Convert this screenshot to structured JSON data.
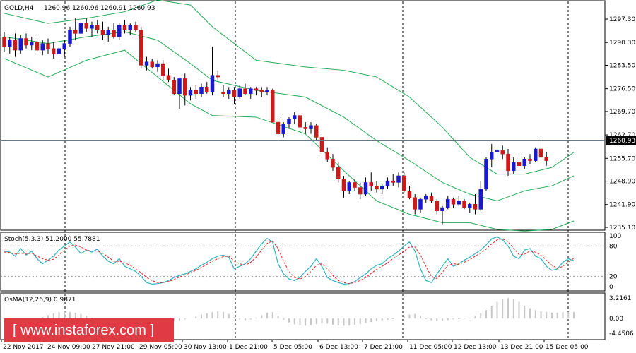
{
  "header": {
    "symbol_label": "GOLD,H4",
    "ohlc_text": "1260.96 1260.96 1260.91 1260.93"
  },
  "price_panel": {
    "current_price": "1260.93",
    "y_ticks": [
      "1297.30",
      "1290.30",
      "1283.50",
      "1276.50",
      "1269.70",
      "1262.70",
      "1255.70",
      "1248.90",
      "1241.90",
      "1235.10"
    ]
  },
  "stoch_panel": {
    "label": "Stoch(5,3,3) 51.2000 55.7881",
    "y_ticks": [
      "100",
      "80",
      "20",
      "0"
    ]
  },
  "osma_panel": {
    "label": "OsMA(12,26,9) 0.9871",
    "y_ticks": [
      "3.2161",
      "0.00",
      "-4.4506"
    ]
  },
  "x_axis": {
    "ticks": [
      "22 Nov 2017",
      "24 Nov 09:00",
      "27 Nov 21:00",
      "29 Nov 05:00",
      "30 Nov 13:00",
      "1 Dec 21:00",
      "5 Dec 05:00",
      "6 Dec 13:00",
      "7 Dec 21:00",
      "11 Dec 05:00",
      "12 Dec 13:00",
      "13 Dec 21:00",
      "15 Dec 05:00"
    ]
  },
  "watermark": {
    "text": "[ www.instaforex.com ]"
  },
  "colors": {
    "bull": "#1a1acc",
    "bear": "#cc1a1a",
    "bands": "#22aa55",
    "stoch_main": "#2fb2c0",
    "stoch_signal": "#ee2222",
    "osma": "#c8c8c8"
  },
  "chart_data": {
    "type": "candlestick",
    "price_range": [
      1235.1,
      1302.0
    ],
    "candles": [
      [
        1292.0,
        1293.5,
        1287.5,
        1289.0
      ],
      [
        1289.0,
        1292.0,
        1287.0,
        1291.0
      ],
      [
        1291.0,
        1293.0,
        1286.0,
        1288.0
      ],
      [
        1288.0,
        1292.5,
        1287.0,
        1291.5
      ],
      [
        1291.5,
        1293.0,
        1288.5,
        1289.5
      ],
      [
        1289.5,
        1292.0,
        1288.0,
        1290.5
      ],
      [
        1290.5,
        1292.0,
        1287.0,
        1288.0
      ],
      [
        1288.0,
        1291.0,
        1286.5,
        1290.0
      ],
      [
        1290.0,
        1291.5,
        1287.0,
        1288.5
      ],
      [
        1288.5,
        1290.5,
        1285.5,
        1287.0
      ],
      [
        1287.0,
        1289.5,
        1285.0,
        1288.5
      ],
      [
        1288.5,
        1291.0,
        1286.0,
        1290.0
      ],
      [
        1290.0,
        1295.0,
        1289.0,
        1294.0
      ],
      [
        1294.0,
        1297.5,
        1291.0,
        1293.0
      ],
      [
        1293.0,
        1298.5,
        1292.0,
        1296.0
      ],
      [
        1296.0,
        1297.5,
        1293.5,
        1294.5
      ],
      [
        1294.5,
        1296.5,
        1292.0,
        1295.5
      ],
      [
        1295.5,
        1297.0,
        1293.0,
        1294.0
      ],
      [
        1294.0,
        1296.5,
        1291.0,
        1292.5
      ],
      [
        1292.5,
        1295.0,
        1290.5,
        1294.0
      ],
      [
        1294.0,
        1296.0,
        1291.5,
        1292.0
      ],
      [
        1292.0,
        1296.0,
        1291.0,
        1295.5
      ],
      [
        1295.5,
        1297.0,
        1293.0,
        1294.0
      ],
      [
        1294.0,
        1296.0,
        1292.5,
        1295.5
      ],
      [
        1295.5,
        1296.5,
        1293.5,
        1294.0
      ],
      [
        1294.0,
        1295.0,
        1282.5,
        1283.5
      ],
      [
        1283.5,
        1286.0,
        1282.0,
        1284.5
      ],
      [
        1284.5,
        1285.5,
        1282.5,
        1283.0
      ],
      [
        1283.0,
        1285.0,
        1281.5,
        1284.0
      ],
      [
        1284.0,
        1285.0,
        1279.0,
        1280.5
      ],
      [
        1280.5,
        1282.5,
        1278.5,
        1279.0
      ],
      [
        1279.0,
        1280.0,
        1274.5,
        1275.0
      ],
      [
        1275.0,
        1278.0,
        1270.5,
        1279.5
      ],
      [
        1279.5,
        1281.0,
        1271.5,
        1274.5
      ],
      [
        1274.5,
        1277.0,
        1273.0,
        1276.0
      ],
      [
        1276.0,
        1277.5,
        1273.5,
        1275.0
      ],
      [
        1275.0,
        1278.0,
        1274.0,
        1277.0
      ],
      [
        1277.0,
        1278.5,
        1275.0,
        1275.5
      ],
      [
        1275.5,
        1289.0,
        1274.5,
        1280.5
      ],
      [
        1280.5,
        1282.0,
        1279.0,
        1280.0
      ],
      [
        1275.5,
        1277.5,
        1274.0,
        1275.0
      ],
      [
        1275.0,
        1277.0,
        1273.5,
        1276.0
      ],
      [
        1276.0,
        1277.0,
        1272.0,
        1274.0
      ],
      [
        1274.0,
        1277.5,
        1273.5,
        1276.5
      ],
      [
        1276.5,
        1278.0,
        1274.5,
        1275.0
      ],
      [
        1275.0,
        1277.0,
        1273.5,
        1276.5
      ],
      [
        1276.5,
        1277.0,
        1274.5,
        1276.0
      ],
      [
        1276.0,
        1277.0,
        1274.0,
        1275.5
      ],
      [
        1275.5,
        1277.0,
        1274.5,
        1276.0
      ],
      [
        1276.0,
        1276.5,
        1270.0,
        1266.5
      ],
      [
        1266.5,
        1268.0,
        1261.5,
        1263.0
      ],
      [
        1263.0,
        1266.5,
        1262.0,
        1266.0
      ],
      [
        1266.0,
        1268.0,
        1264.5,
        1267.5
      ],
      [
        1267.5,
        1269.5,
        1266.0,
        1268.5
      ],
      [
        1268.5,
        1269.0,
        1264.0,
        1265.0
      ],
      [
        1265.0,
        1266.5,
        1263.0,
        1264.5
      ],
      [
        1264.5,
        1266.5,
        1263.0,
        1265.5
      ],
      [
        1265.5,
        1266.0,
        1261.0,
        1262.0
      ],
      [
        1262.0,
        1264.0,
        1256.0,
        1257.5
      ],
      [
        1257.5,
        1259.0,
        1254.5,
        1255.5
      ],
      [
        1255.5,
        1257.0,
        1252.0,
        1253.0
      ],
      [
        1253.0,
        1254.5,
        1248.5,
        1249.5
      ],
      [
        1249.5,
        1250.5,
        1244.0,
        1246.0
      ],
      [
        1246.0,
        1249.0,
        1245.0,
        1248.5
      ],
      [
        1248.5,
        1249.5,
        1246.0,
        1247.0
      ],
      [
        1247.0,
        1248.5,
        1243.5,
        1245.0
      ],
      [
        1245.0,
        1250.0,
        1244.5,
        1248.5
      ],
      [
        1248.5,
        1251.5,
        1246.0,
        1247.5
      ],
      [
        1247.5,
        1249.0,
        1245.5,
        1246.5
      ],
      [
        1246.5,
        1248.0,
        1245.0,
        1247.5
      ],
      [
        1247.5,
        1250.0,
        1246.5,
        1249.0
      ],
      [
        1249.0,
        1251.0,
        1247.5,
        1248.5
      ],
      [
        1248.5,
        1251.5,
        1247.0,
        1250.5
      ],
      [
        1250.5,
        1251.5,
        1245.5,
        1246.0
      ],
      [
        1246.0,
        1247.5,
        1243.5,
        1244.0
      ],
      [
        1244.0,
        1245.0,
        1239.0,
        1240.5
      ],
      [
        1240.5,
        1244.0,
        1239.5,
        1243.5
      ],
      [
        1243.5,
        1245.0,
        1242.5,
        1244.5
      ],
      [
        1244.5,
        1245.5,
        1242.5,
        1243.0
      ],
      [
        1243.0,
        1243.5,
        1239.0,
        1240.0
      ],
      [
        1240.0,
        1241.5,
        1236.0,
        1241.0
      ],
      [
        1241.0,
        1244.5,
        1240.5,
        1243.5
      ],
      [
        1243.5,
        1244.0,
        1241.0,
        1242.0
      ],
      [
        1242.0,
        1244.5,
        1241.5,
        1243.0
      ],
      [
        1243.0,
        1243.5,
        1240.5,
        1241.0
      ],
      [
        1241.0,
        1242.5,
        1239.5,
        1242.0
      ],
      [
        1242.0,
        1245.0,
        1239.0,
        1240.5
      ],
      [
        1240.5,
        1249.0,
        1240.0,
        1246.5
      ],
      [
        1246.5,
        1256.0,
        1246.0,
        1255.5
      ],
      [
        1255.5,
        1260.0,
        1253.0,
        1257.5
      ],
      [
        1257.5,
        1259.0,
        1255.0,
        1258.0
      ],
      [
        1258.0,
        1259.5,
        1255.5,
        1257.0
      ],
      [
        1257.0,
        1258.5,
        1250.5,
        1252.0
      ],
      [
        1252.0,
        1256.0,
        1251.0,
        1254.5
      ],
      [
        1254.5,
        1256.5,
        1252.5,
        1253.5
      ],
      [
        1253.5,
        1256.0,
        1252.5,
        1255.5
      ],
      [
        1255.5,
        1257.0,
        1254.0,
        1255.0
      ],
      [
        1255.0,
        1259.0,
        1254.5,
        1258.5
      ],
      [
        1258.5,
        1262.5,
        1255.0,
        1256.0
      ],
      [
        1256.0,
        1257.5,
        1253.5,
        1255.0
      ]
    ],
    "bands": {
      "upper": [
        [
          0,
          1299
        ],
        [
          8,
          1296
        ],
        [
          15,
          1297.5
        ],
        [
          22,
          1299.5
        ],
        [
          28,
          1303.0
        ],
        [
          34,
          1301.5
        ],
        [
          38,
          1295
        ],
        [
          46,
          1285
        ],
        [
          55,
          1283
        ],
        [
          62,
          1282
        ],
        [
          68,
          1280
        ],
        [
          74,
          1274
        ],
        [
          80,
          1265
        ],
        [
          85,
          1256
        ],
        [
          90,
          1251
        ],
        [
          95,
          1251
        ],
        [
          100,
          1253
        ],
        [
          104,
          1257.5
        ]
      ],
      "middle": [
        [
          0,
          1292
        ],
        [
          8,
          1290
        ],
        [
          15,
          1292
        ],
        [
          22,
          1293.5
        ],
        [
          28,
          1291
        ],
        [
          34,
          1284
        ],
        [
          38,
          1279
        ],
        [
          46,
          1276
        ],
        [
          55,
          1274
        ],
        [
          62,
          1268
        ],
        [
          68,
          1261
        ],
        [
          74,
          1255
        ],
        [
          80,
          1248.5
        ],
        [
          85,
          1245
        ],
        [
          90,
          1243
        ],
        [
          95,
          1246
        ],
        [
          100,
          1247.5
        ],
        [
          104,
          1250.5
        ]
      ],
      "lower": [
        [
          0,
          1285.5
        ],
        [
          8,
          1280
        ],
        [
          15,
          1285
        ],
        [
          22,
          1288
        ],
        [
          28,
          1280
        ],
        [
          34,
          1272
        ],
        [
          38,
          1268.5
        ],
        [
          46,
          1268
        ],
        [
          55,
          1263
        ],
        [
          62,
          1252
        ],
        [
          68,
          1243
        ],
        [
          74,
          1239
        ],
        [
          80,
          1236.5
        ],
        [
          85,
          1236.5
        ],
        [
          90,
          1234.5
        ],
        [
          95,
          1234
        ],
        [
          100,
          1234.5
        ],
        [
          104,
          1237
        ]
      ]
    },
    "stochastic": {
      "main": [
        70,
        68,
        60,
        75,
        62,
        70,
        55,
        45,
        52,
        60,
        72,
        80,
        88,
        78,
        65,
        72,
        68,
        74,
        60,
        50,
        45,
        55,
        40,
        35,
        30,
        20,
        8,
        5,
        6,
        8,
        12,
        18,
        22,
        25,
        30,
        35,
        42,
        48,
        55,
        60,
        62,
        58,
        35,
        40,
        45,
        55,
        70,
        84,
        95,
        88,
        45,
        25,
        15,
        12,
        18,
        30,
        40,
        55,
        40,
        18,
        12,
        8,
        5,
        6,
        10,
        18,
        25,
        35,
        42,
        45,
        55,
        62,
        70,
        80,
        88,
        70,
        35,
        12,
        8,
        25,
        40,
        55,
        40,
        45,
        52,
        58,
        65,
        72,
        82,
        94,
        98,
        92,
        80,
        60,
        55,
        72,
        75,
        60,
        55,
        40,
        32,
        35,
        48,
        55,
        51
      ],
      "signal": [
        68,
        67,
        64,
        66,
        64,
        66,
        60,
        55,
        52,
        54,
        62,
        72,
        80,
        82,
        78,
        72,
        70,
        70,
        66,
        58,
        50,
        50,
        47,
        42,
        35,
        27,
        18,
        12,
        8,
        8,
        10,
        14,
        19,
        23,
        27,
        32,
        38,
        44,
        50,
        55,
        59,
        60,
        50,
        45,
        42,
        48,
        58,
        72,
        85,
        90,
        75,
        50,
        30,
        18,
        15,
        20,
        30,
        42,
        45,
        35,
        22,
        12,
        8,
        6,
        8,
        12,
        18,
        26,
        34,
        40,
        47,
        55,
        62,
        70,
        78,
        78,
        62,
        40,
        20,
        16,
        28,
        42,
        45,
        44,
        48,
        53,
        60,
        66,
        74,
        84,
        92,
        94,
        88,
        76,
        63,
        64,
        70,
        68,
        62,
        52,
        42,
        36,
        40,
        48,
        56
      ]
    },
    "osma": [
      -0.2,
      -0.4,
      -0.6,
      -0.7,
      -0.6,
      -0.3,
      -0.1,
      0.2,
      0.5,
      0.8,
      1.0,
      1.1,
      1.0,
      0.9,
      0.7,
      0.4,
      0.1,
      -0.3,
      -0.7,
      -1.1,
      -1.5,
      -1.9,
      -2.2,
      -2.4,
      -2.5,
      -2.4,
      -2.2,
      -2.0,
      -1.8,
      -1.5,
      -1.2,
      -0.9,
      -0.6,
      -0.3,
      0.0,
      0.3,
      0.6,
      0.8,
      1.0,
      1.1,
      1.0,
      0.7,
      0.2,
      -0.3,
      -0.5,
      -0.3,
      0.1,
      0.5,
      0.9,
      1.0,
      0.4,
      -0.4,
      -1.2,
      -1.8,
      -2.1,
      -2.2,
      -2.0,
      -1.7,
      -1.5,
      -1.6,
      -1.9,
      -2.1,
      -2.2,
      -2.1,
      -1.9,
      -1.7,
      -1.4,
      -1.1,
      -0.8,
      -0.6,
      -0.4,
      -0.2,
      0.0,
      0.3,
      0.6,
      0.7,
      0.4,
      -0.2,
      -0.6,
      -0.8,
      -0.7,
      -0.5,
      -0.3,
      -0.2,
      -0.1,
      0.1,
      0.4,
      0.8,
      1.3,
      2.0,
      2.6,
      3.0,
      3.2,
      3.0,
      2.6,
      2.0,
      1.6,
      1.3,
      1.1,
      1.0,
      0.9,
      0.9,
      1.0,
      1.0,
      0.99
    ]
  }
}
